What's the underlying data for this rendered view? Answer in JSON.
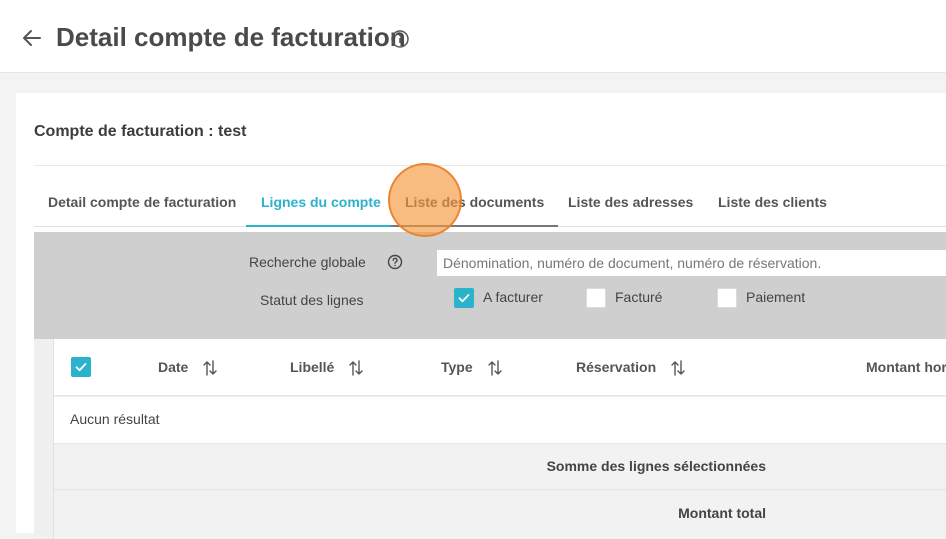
{
  "header": {
    "title": "Detail compte de facturation",
    "back_icon": "arrow-left-icon",
    "info_icon": "info-circle-icon"
  },
  "account": {
    "title": "Compte de facturation : test"
  },
  "tabs": [
    {
      "label": "Detail compte de facturation",
      "active": false
    },
    {
      "label": "Lignes du compte",
      "active": true
    },
    {
      "label": "Liste des documents",
      "active": false
    },
    {
      "label": "Liste des adresses",
      "active": false
    },
    {
      "label": "Liste des clients",
      "active": false
    }
  ],
  "filters": {
    "search_label": "Recherche globale",
    "search_placeholder": "Dénomination, numéro de document, numéro de réservation.",
    "search_value": "",
    "status_label": "Statut des lignes",
    "statuses": [
      {
        "label": "A facturer",
        "checked": true
      },
      {
        "label": "Facturé",
        "checked": false
      },
      {
        "label": "Paiement",
        "checked": false
      }
    ]
  },
  "table": {
    "select_all_checked": true,
    "columns": [
      "Date",
      "Libellé",
      "Type",
      "Réservation",
      "Montant hor"
    ],
    "empty_text": "Aucun résultat",
    "sum_label": "Somme des lignes sélectionnées",
    "total_label": "Montant total"
  },
  "colors": {
    "accent": "#2bb3cc",
    "filter_bg": "#cfcfcf",
    "cursor_highlight": "#f4963c"
  }
}
